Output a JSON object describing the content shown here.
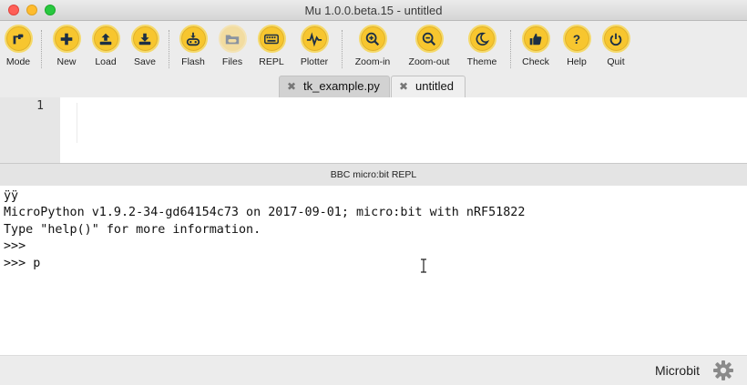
{
  "window": {
    "title": "Mu 1.0.0.beta.15 - untitled"
  },
  "toolbar": {
    "buttons": [
      {
        "label": "Mode",
        "icon": "mode-icon"
      },
      {
        "label": "New",
        "icon": "plus-icon"
      },
      {
        "label": "Load",
        "icon": "upload-icon"
      },
      {
        "label": "Save",
        "icon": "download-icon"
      },
      {
        "label": "Flash",
        "icon": "flash-icon"
      },
      {
        "label": "Files",
        "icon": "files-icon"
      },
      {
        "label": "REPL",
        "icon": "keyboard-icon"
      },
      {
        "label": "Plotter",
        "icon": "pulse-icon"
      },
      {
        "label": "Zoom-in",
        "icon": "zoom-in-icon"
      },
      {
        "label": "Zoom-out",
        "icon": "zoom-out-icon"
      },
      {
        "label": "Theme",
        "icon": "moon-icon"
      },
      {
        "label": "Check",
        "icon": "thumbs-up-icon"
      },
      {
        "label": "Help",
        "icon": "question-icon"
      },
      {
        "label": "Quit",
        "icon": "power-icon"
      }
    ]
  },
  "tabs": [
    {
      "label": "tk_example.py",
      "close": "✖",
      "active": false
    },
    {
      "label": "untitled",
      "close": "✖",
      "active": true
    }
  ],
  "editor": {
    "line_numbers": [
      "1"
    ]
  },
  "repl": {
    "title": "BBC micro:bit REPL",
    "lines": [
      "ÿÿ",
      "MicroPython v1.9.2-34-gd64154c73 on 2017-09-01; micro:bit with nRF51822",
      "Type \"help()\" for more information.",
      ">>>",
      ">>> p"
    ]
  },
  "status": {
    "mode": "Microbit",
    "icon": "gear-icon"
  },
  "colors": {
    "button": "#f7c62f",
    "button_ring": "#f5d96a",
    "background": "#ececec"
  }
}
